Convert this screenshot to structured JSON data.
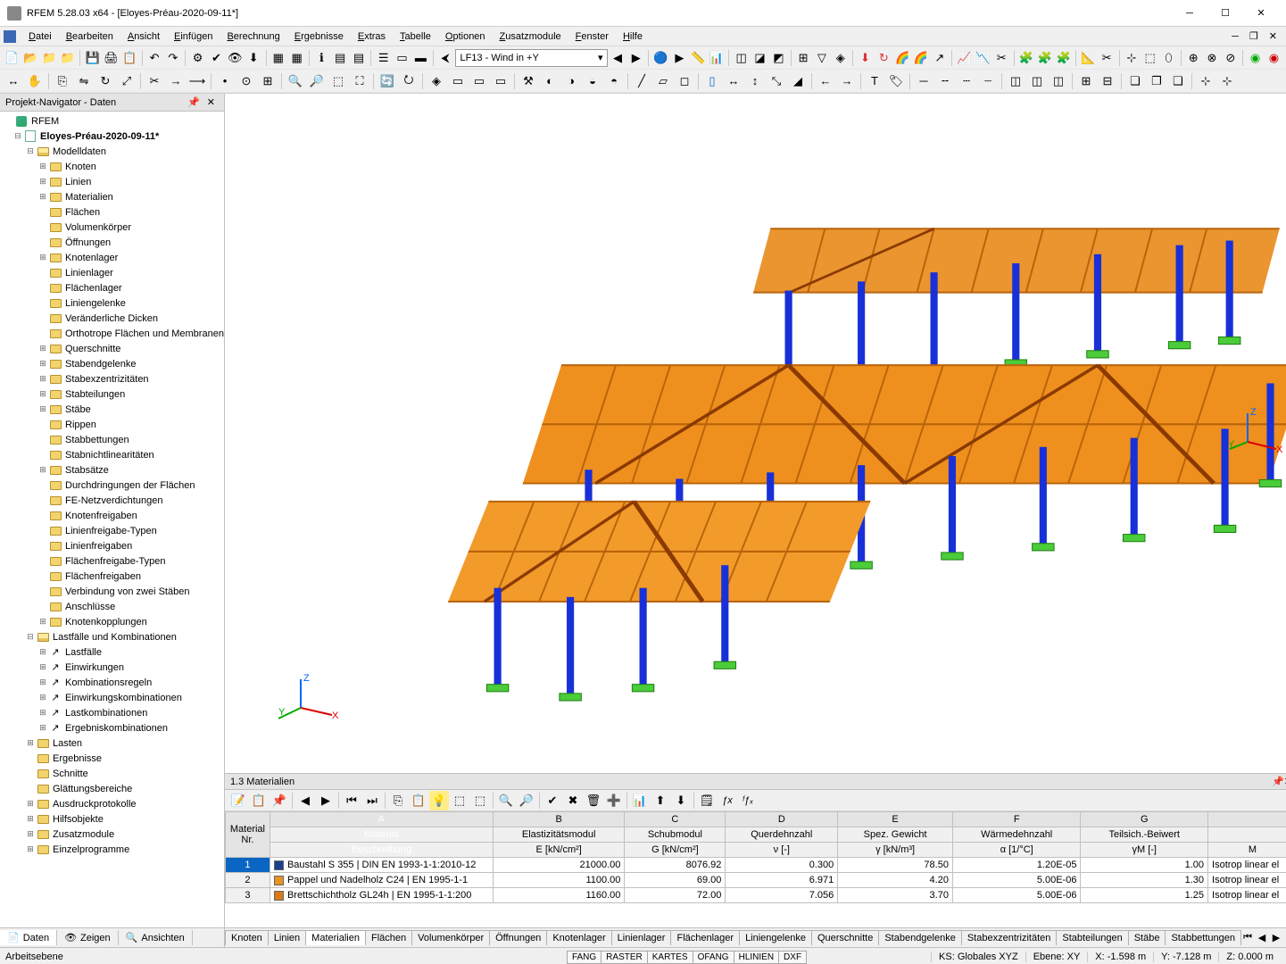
{
  "title": "RFEM 5.28.03 x64 - [Eloyes-Préau-2020-09-11*]",
  "menu": [
    "Datei",
    "Bearbeiten",
    "Ansicht",
    "Einfügen",
    "Berechnung",
    "Ergebnisse",
    "Extras",
    "Tabelle",
    "Optionen",
    "Zusatzmodule",
    "Fenster",
    "Hilfe"
  ],
  "loadcase": "LF13 - Wind in +Y",
  "navigator": {
    "title": "Projekt-Navigator - Daten",
    "root": "RFEM",
    "project": "Eloyes-Préau-2020-09-11*",
    "modelldaten": "Modelldaten",
    "md_items": [
      "Knoten",
      "Linien",
      "Materialien",
      "Flächen",
      "Volumenkörper",
      "Öffnungen",
      "Knotenlager",
      "Linienlager",
      "Flächenlager",
      "Liniengelenke",
      "Veränderliche Dicken",
      "Orthotrope Flächen und Membranen",
      "Querschnitte",
      "Stabendgelenke",
      "Stabexzentrizitäten",
      "Stabteilungen",
      "Stäbe",
      "Rippen",
      "Stabbettungen",
      "Stabnichtlinearitäten",
      "Stabsätze",
      "Durchdringungen der Flächen",
      "FE-Netzverdichtungen",
      "Knotenfreigaben",
      "Linienfreigabe-Typen",
      "Linienfreigaben",
      "Flächenfreigabe-Typen",
      "Flächenfreigaben",
      "Verbindung von zwei Stäben",
      "Anschlüsse",
      "Knotenkopplungen"
    ],
    "md_has_children": {
      "Knoten": true,
      "Linien": true,
      "Materialien": true,
      "Knotenlager": true,
      "Querschnitte": true,
      "Stabendgelenke": true,
      "Stabexzentrizitäten": true,
      "Stabteilungen": true,
      "Stäbe": true,
      "Stabsätze": true,
      "Knotenkopplungen": true
    },
    "lastfalle": "Lastfälle und Kombinationen",
    "lf_items": [
      "Lastfälle",
      "Einwirkungen",
      "Kombinationsregeln",
      "Einwirkungskombinationen",
      "Lastkombinationen",
      "Ergebniskombinationen"
    ],
    "tail": [
      "Lasten",
      "Ergebnisse",
      "Schnitte",
      "Glättungsbereiche",
      "Ausdruckprotokolle",
      "Hilfsobjekte",
      "Zusatzmodule",
      "Einzelprogramme"
    ],
    "tail_has_children": {
      "Lasten": true,
      "Ausdruckprotokolle": true,
      "Hilfsobjekte": true,
      "Zusatzmodule": true,
      "Einzelprogramme": true
    },
    "tabs": [
      "Daten",
      "Zeigen",
      "Ansichten"
    ]
  },
  "tablepane": {
    "title": "1.3 Materialien",
    "col_letters": [
      "A",
      "B",
      "C",
      "D",
      "E",
      "F",
      "G"
    ],
    "rowhdr1": "Material",
    "rowhdr2": "Nr.",
    "cols1": [
      "Material",
      "Elastizitätsmodul",
      "Schubmodul",
      "Querdehnzahl",
      "Spez. Gewicht",
      "Wärmedehnzahl",
      "Teilsich.-Beiwert",
      ""
    ],
    "cols2": [
      "Beschreibung",
      "E [kN/cm²]",
      "G [kN/cm²]",
      "ν [-]",
      "γ [kN/m³]",
      "α [1/°C]",
      "γM [-]",
      "M"
    ],
    "rows": [
      {
        "nr": "1",
        "color": "#1a3f8c",
        "desc": "Baustahl S 355 | DIN EN 1993-1-1:2010-12",
        "E": "21000.00",
        "G": "8076.92",
        "nu": "0.300",
        "g": "78.50",
        "a": "1.20E-05",
        "gm": "1.00",
        "mm": "Isotrop linear el"
      },
      {
        "nr": "2",
        "color": "#e89424",
        "desc": "Pappel und Nadelholz C24 | EN 1995-1-1",
        "E": "1100.00",
        "G": "69.00",
        "nu": "6.971",
        "g": "4.20",
        "a": "5.00E-06",
        "gm": "1.30",
        "mm": "Isotrop linear el"
      },
      {
        "nr": "3",
        "color": "#d87a1a",
        "desc": "Brettschichtholz GL24h | EN 1995-1-1:200",
        "E": "1160.00",
        "G": "72.00",
        "nu": "7.056",
        "g": "3.70",
        "a": "5.00E-06",
        "gm": "1.25",
        "mm": "Isotrop linear el"
      }
    ]
  },
  "bottomTabs": [
    "Knoten",
    "Linien",
    "Materialien",
    "Flächen",
    "Volumenkörper",
    "Öffnungen",
    "Knotenlager",
    "Linienlager",
    "Flächenlager",
    "Liniengelenke",
    "Querschnitte",
    "Stabendgelenke",
    "Stabexzentrizitäten",
    "Stabteilungen",
    "Stäbe",
    "Stabbettungen"
  ],
  "status": {
    "left": "Arbeitsebene",
    "toggles": [
      "FANG",
      "RASTER",
      "KARTES",
      "OFANG",
      "HLINIEN",
      "DXF"
    ],
    "ks": "KS: Globales XYZ",
    "ebene": "Ebene: XY",
    "x": "X: -1.598 m",
    "y": "Y: -7.128 m",
    "z": "Z:  0.000 m"
  },
  "fx": "ƒx",
  "fxstar": "ᶠƒₓ"
}
